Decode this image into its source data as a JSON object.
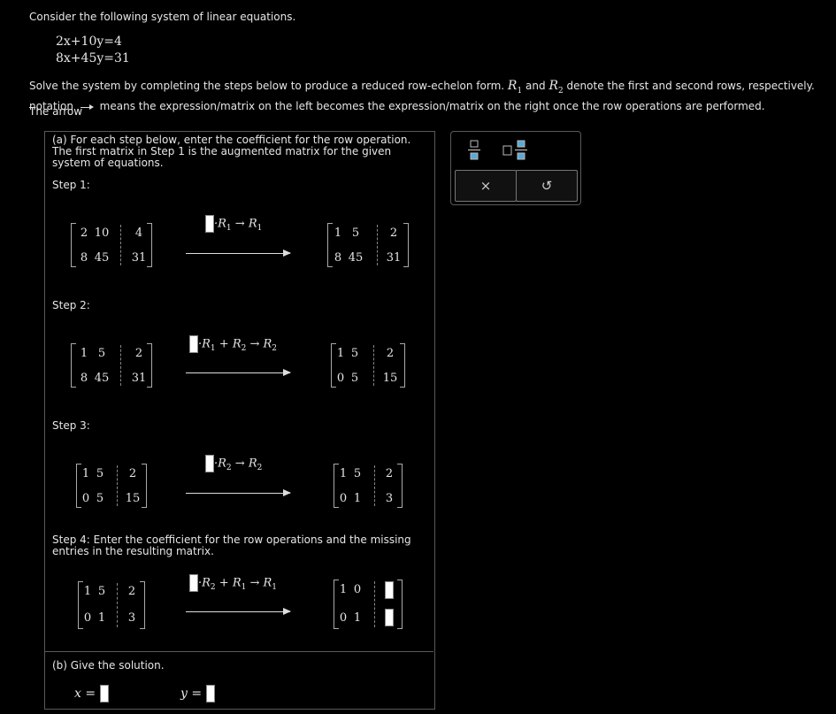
{
  "intro": "Consider the following system of linear equations.",
  "equations": [
    "2x+10y=4",
    "8x+45y=31"
  ],
  "instructions": {
    "line1_a": "Solve the system by completing the steps below to produce a reduced row-echelon form.",
    "r1": "R",
    "and": "and",
    "line1_b": "denote the first and second rows, respectively. The arrow",
    "line2_a": "notation",
    "line2_b": "means the expression/matrix on the left becomes the expression/matrix on the right once the row operations are performed."
  },
  "part_a": {
    "prompt": "(a) For each step below, enter the coefficient for the row operation. The first matrix in Step 1 is the augmented matrix for the given system of equations.",
    "steps": [
      {
        "label": "Step 1:",
        "left": [
          [
            "2",
            "10",
            "4"
          ],
          [
            "8",
            "45",
            "31"
          ]
        ],
        "op": "·R1 → R1",
        "right": [
          [
            "1",
            "5",
            "2"
          ],
          [
            "8",
            "45",
            "31"
          ]
        ]
      },
      {
        "label": "Step 2:",
        "left": [
          [
            "1",
            "5",
            "2"
          ],
          [
            "8",
            "45",
            "31"
          ]
        ],
        "op": "·R1 + R2 → R2",
        "right": [
          [
            "1",
            "5",
            "2"
          ],
          [
            "0",
            "5",
            "15"
          ]
        ]
      },
      {
        "label": "Step 3:",
        "left": [
          [
            "1",
            "5",
            "2"
          ],
          [
            "0",
            "5",
            "15"
          ]
        ],
        "op": "·R2 → R2",
        "right": [
          [
            "1",
            "5",
            "2"
          ],
          [
            "0",
            "1",
            "3"
          ]
        ]
      },
      {
        "label": "Step 4: Enter the coefficient for the row operations and the missing entries in the resulting matrix.",
        "left": [
          [
            "1",
            "5",
            "2"
          ],
          [
            "0",
            "1",
            "3"
          ]
        ],
        "op": "·R2 + R1 → R1",
        "right": [
          [
            "1",
            "0",
            ""
          ],
          [
            "0",
            "1",
            ""
          ]
        ]
      }
    ]
  },
  "part_b": {
    "prompt": "(b) Give the solution.",
    "x_label": "x =",
    "y_label": "y ="
  },
  "toolbar": {
    "fraction_icon": "fraction-icon",
    "mixed_number_icon": "mixed-number-icon",
    "clear_label": "×",
    "undo_label": "↺"
  }
}
